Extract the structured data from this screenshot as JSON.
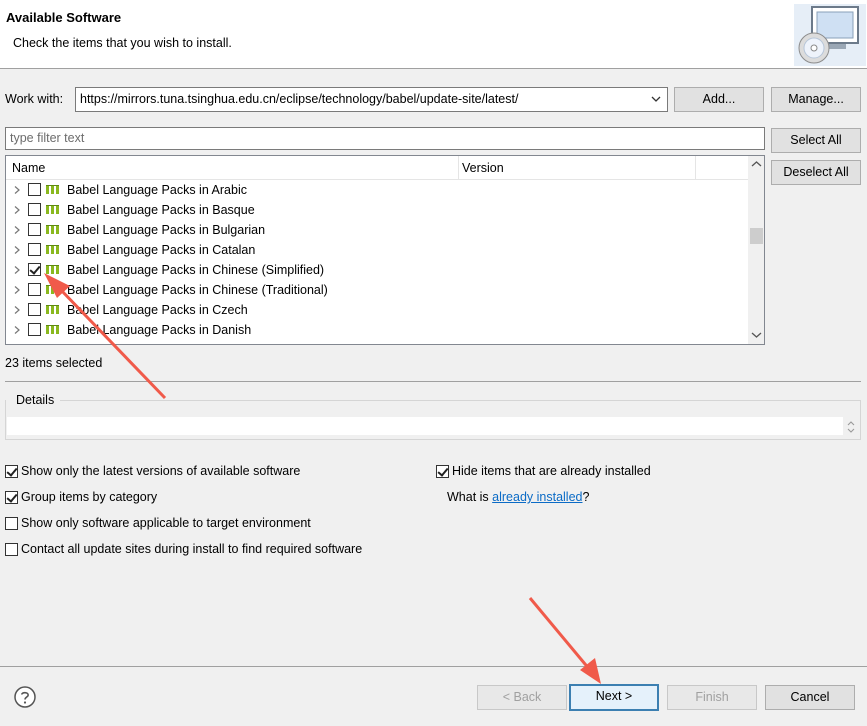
{
  "header": {
    "title": "Available Software",
    "subtitle": "Check the items that you wish to install."
  },
  "work_with": {
    "label": "Work with:",
    "value": "https://mirrors.tuna.tsinghua.edu.cn/eclipse/technology/babel/update-site/latest/",
    "add_label": "Add...",
    "manage_label": "Manage..."
  },
  "filter": {
    "placeholder": "type filter text"
  },
  "side_buttons": {
    "select_all": "Select All",
    "deselect_all": "Deselect All"
  },
  "table": {
    "columns": [
      "Name",
      "Version"
    ],
    "rows": [
      {
        "label": "Babel Language Packs in Arabic",
        "checked": false
      },
      {
        "label": "Babel Language Packs in Basque",
        "checked": false
      },
      {
        "label": "Babel Language Packs in Bulgarian",
        "checked": false
      },
      {
        "label": "Babel Language Packs in Catalan",
        "checked": false
      },
      {
        "label": "Babel Language Packs in Chinese (Simplified)",
        "checked": true
      },
      {
        "label": "Babel Language Packs in Chinese (Traditional)",
        "checked": false
      },
      {
        "label": "Babel Language Packs in Czech",
        "checked": false
      },
      {
        "label": "Babel Language Packs in Danish",
        "checked": false
      }
    ]
  },
  "selected_count": "23 items selected",
  "details": {
    "label": "Details"
  },
  "options": {
    "latest": {
      "label": "Show only the latest versions of available software",
      "checked": true
    },
    "group": {
      "label": "Group items by category",
      "checked": true
    },
    "applicable": {
      "label": "Show only software applicable to target environment",
      "checked": false
    },
    "contact": {
      "label": "Contact all update sites during install to find required software",
      "checked": false
    },
    "hide": {
      "label": "Hide items that are already installed",
      "checked": true
    },
    "whatis_prefix": "What is ",
    "whatis_link": "already installed",
    "whatis_suffix": "?"
  },
  "footer": {
    "back": "< Back",
    "next": "Next >",
    "finish": "Finish",
    "cancel": "Cancel"
  },
  "colors": {
    "annotation_arrow": "#f05a4a",
    "link": "#0b6bc6",
    "package_icon": "#8ab81e"
  }
}
